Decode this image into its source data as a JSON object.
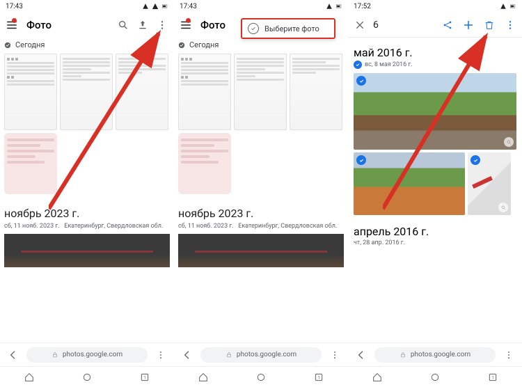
{
  "status": {
    "time1": "17:43",
    "time2": "17:43",
    "time3": "17:52"
  },
  "panel1": {
    "title": "Фото",
    "today": "Сегодня",
    "month": "ноябрь 2023 г.",
    "date": "сб, 11 нояб. 2023 г.",
    "location": "Екатеринбург, Свердловская обл."
  },
  "panel2": {
    "title": "Фото",
    "select_label": "Выберите фото",
    "today": "Сегодня",
    "month": "ноябрь 2023 г.",
    "date": "сб, 11 нояб. 2023 г.",
    "location": "Екатеринбург, Свердловская обл."
  },
  "panel3": {
    "count": "6",
    "month1": "май 2016 г.",
    "date1": "вс, 8 мая 2016 г.",
    "month2": "апрель 2016 г.",
    "date2": "чт, 28 апр. 2016 г."
  },
  "browser": {
    "url": "photos.google.com",
    "tab_count": "1"
  }
}
